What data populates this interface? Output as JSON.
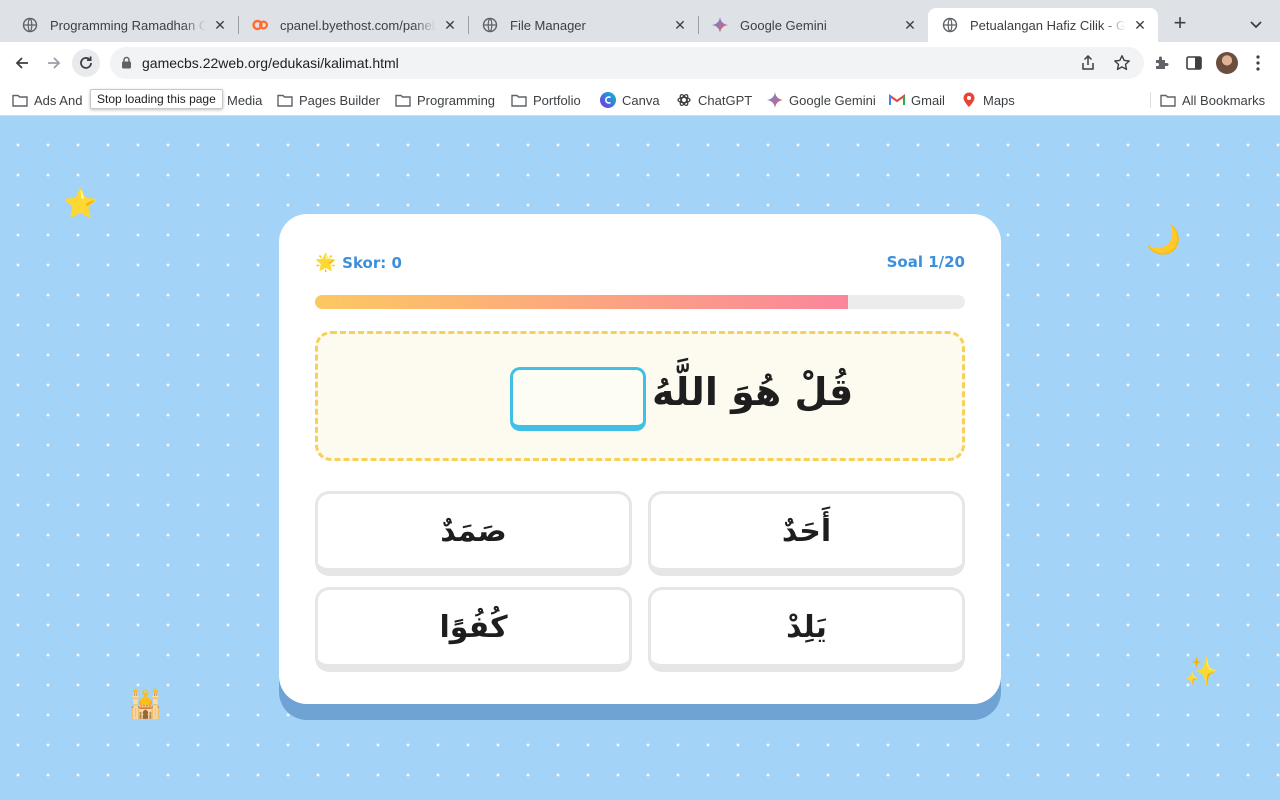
{
  "browser": {
    "tabs": [
      {
        "title": "Programming Ramadhan Class",
        "icon": "globe-icon"
      },
      {
        "title": "cpanel.byethost.com/panel/index.php",
        "icon": "cpanel-icon"
      },
      {
        "title": "File Manager",
        "icon": "globe-icon"
      },
      {
        "title": "Google Gemini",
        "icon": "gemini-icon"
      },
      {
        "title": "Petualangan Hafiz Cilik - Game",
        "icon": "globe-icon"
      }
    ],
    "address": "gamecbs.22web.org/edukasi/kalimat.html",
    "tooltip": "Stop loading this page",
    "bookmarks": [
      {
        "label": "Ads And",
        "icon": "folder-icon"
      },
      {
        "label": "Media",
        "icon": "folder-icon"
      },
      {
        "label": "Pages Builder",
        "icon": "folder-icon"
      },
      {
        "label": "Programming",
        "icon": "folder-icon"
      },
      {
        "label": "Portfolio",
        "icon": "folder-icon"
      },
      {
        "label": "Canva",
        "icon": "canva-icon"
      },
      {
        "label": "ChatGPT",
        "icon": "chatgpt-icon"
      },
      {
        "label": "Google Gemini",
        "icon": "gemini-icon"
      },
      {
        "label": "Gmail",
        "icon": "gmail-icon"
      },
      {
        "label": "Maps",
        "icon": "maps-icon"
      }
    ],
    "all_bookmarks": "All Bookmarks"
  },
  "game": {
    "score_icon": "🌟",
    "score": "Skor: 0",
    "question_number": "Soal 1/20",
    "progress": 0.82,
    "verse": "قُلْ هُوَ اللَّهُ",
    "options": [
      "أَحَدٌ",
      "صَمَدٌ",
      "يَلِدْ",
      "كُفُوًا"
    ],
    "decorations": {
      "star": "⭐",
      "moon": "🌙",
      "mosque": "🕌",
      "sparkles": "✨"
    },
    "colors": {
      "background": "#a3d3f7",
      "accent_text": "#3d8fdc",
      "progress_start": "#fcc862",
      "progress_end": "#fb869c",
      "question_border": "#f7cf5a",
      "answer_slot_border": "#40c0e6"
    }
  }
}
